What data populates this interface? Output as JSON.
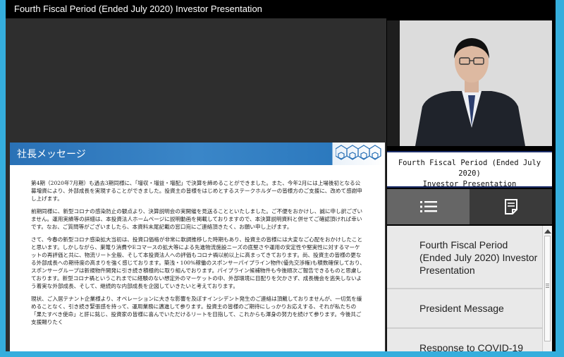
{
  "window": {
    "title": "Fourth Fiscal Period (Ended July 2020) Investor Presentation"
  },
  "slide": {
    "header": "社長メッセージ",
    "paragraphs": [
      "第4期（2020年7月期）も過去3期同様に、「増収・増益・増配」で決算を締めることができました。また、今年2月には上場後初となる公募増資により、外部成長を実現することができました。投資主の皆様をはじめとするステークホルダーの皆様方のご支援に、改めて感謝申し上げます。",
      "前期同様に、新型コロナの感染防止の観点より、決算説明会の実開催を見送ることといたしました。ご不便をおかけし、誠に申し訳ございません。運用実績等の詳細は、本投資法人ホームページに説明動画を掲載しておりますので、本決算説明資料と併せてご確認頂ければ幸いです。なお、ご質問等がございましたら、本資料末尾記載の窓口宛にご連絡頂きたく、お願い申し上げます。",
      "さて、今春の新型コロナ感染拡大当初は、投資口価格が非常に軟調推移した時期もあり、投資主の皆様には大変なご心配をおかけしたことと思います。しかしながら、巣篭り消費やEコマースの拡大等による先進物流施設ニーズの底堅さや運用の安定性や堅実性に対するマーケットの再評価と共に、物流リート全般、そして本投資法人への評価もコロナ禍以前以上に高まってきております。尚、投資主の皆様の更なる外部成長への期待度の高まりを強く感じております。築浅・100%稼働のスポンサーパイプライン物件(優先交渉権)も積数確保しており、スポンサーグループは新規物件開発に引き続き積極的に取り組んでおります。パイプライン候補物件も今後順次ご報告できるものと思慮しております。新型コロナ禍というこれまでに経験のない想定外のマーケットの中、外部環境に目配りを欠かさず、成長機会を逃失しないよう着実な外部成長、そして、継続的な内部成長を企図していきたいと考えております。",
      "現状、ご入居テナント企業様より、オペレーションに大きな影響を及ぼすインシデント発生のご連絡は頂戴しておりませんが、一切気を緩めることなく、引き続き緊張感を持って、運用業務に邁進して参ります。投資主の皆様のご期待にしっかりお応えする、それが私たちの「果たすべき使命」と肝に銘じ、投資家の皆様に喜んでいただけるリートを目指して、これからも渾身の努力を続けて参ります。今後共ご支援賜りたく"
    ]
  },
  "speaker_label": {
    "line1": "Fourth Fiscal Period (Ended July 2020)",
    "line2": "Investor Presentation"
  },
  "tabs": {
    "chapters_icon": "list-icon",
    "documents_icon": "document-icon"
  },
  "chapters": [
    "Fourth Fiscal Period (Ended July 2020) Investor Presentation",
    "President Message",
    "Response to COVID-19"
  ],
  "colors": {
    "frame": "#35aedd",
    "slide_header": "#2a71b6",
    "label_border": "#1d2f6b"
  }
}
